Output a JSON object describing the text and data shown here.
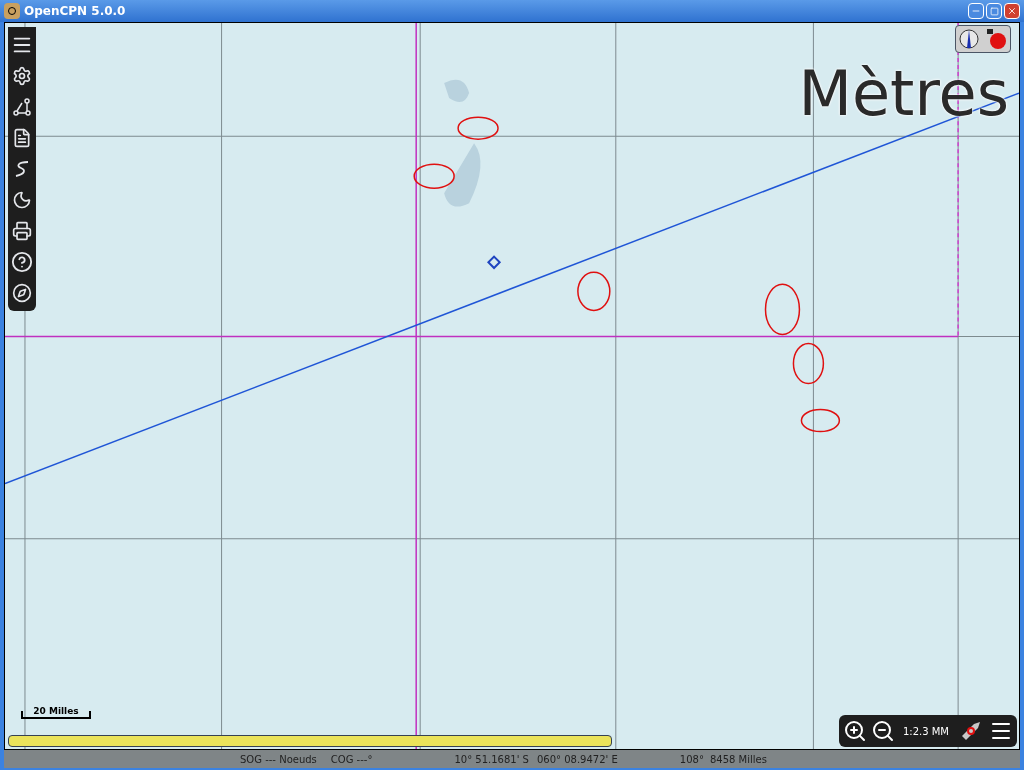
{
  "window": {
    "title": "OpenCPN 5.0.0"
  },
  "chart": {
    "units_label": "Mètres",
    "scale_bar": "20 Milles"
  },
  "zoom_controls": {
    "scale": "1:2.3 MM"
  },
  "status_bar": {
    "sog": "SOG --- Noeuds",
    "cog": "COG ---°",
    "latitude": "10° 51.1681' S",
    "longitude": "060° 08.9472' E",
    "bearing": "108°",
    "distance": "8458 Milles"
  }
}
